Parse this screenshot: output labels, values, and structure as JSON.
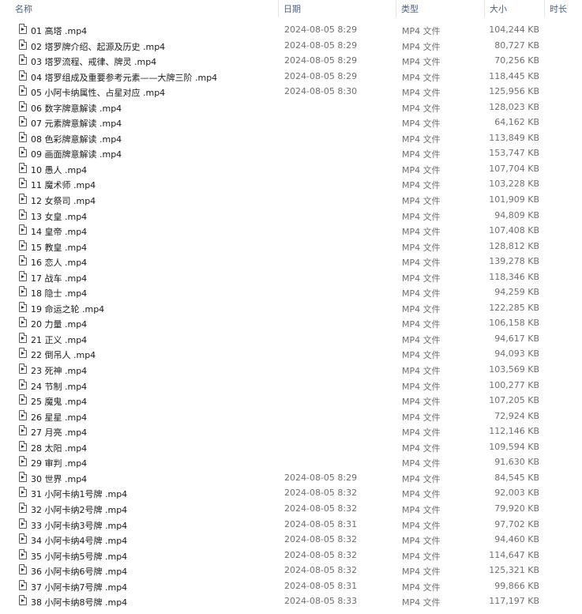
{
  "columns": {
    "name": "名称",
    "date": "日期",
    "type": "类型",
    "size": "大小",
    "duration": "时长"
  },
  "files": [
    {
      "name": "01 高塔 .mp4",
      "date": "2024-08-05 8:29",
      "type": "MP4 文件",
      "size": "104,244 KB"
    },
    {
      "name": "02 塔罗牌介绍、起源及历史 .mp4",
      "date": "2024-08-05 8:29",
      "type": "MP4 文件",
      "size": "80,727 KB"
    },
    {
      "name": "03 塔罗流程、戒律、牌灵 .mp4",
      "date": "2024-08-05 8:29",
      "type": "MP4 文件",
      "size": "70,256 KB"
    },
    {
      "name": "04 塔罗组成及重要参考元素——大牌三阶 .mp4",
      "date": "2024-08-05 8:29",
      "type": "MP4 文件",
      "size": "118,445 KB"
    },
    {
      "name": "05 小阿卡纳属性、占星对应 .mp4",
      "date": "2024-08-05 8:30",
      "type": "MP4 文件",
      "size": "125,956 KB"
    },
    {
      "name": "06 数字牌意解读 .mp4",
      "date": "",
      "type": "MP4 文件",
      "size": "128,023 KB"
    },
    {
      "name": "07 元素牌意解读 .mp4",
      "date": "",
      "type": "MP4 文件",
      "size": "64,162 KB"
    },
    {
      "name": "08 色彩牌意解读 .mp4",
      "date": "",
      "type": "MP4 文件",
      "size": "113,849 KB"
    },
    {
      "name": "09 画面牌意解读 .mp4",
      "date": "",
      "type": "MP4 文件",
      "size": "153,747 KB"
    },
    {
      "name": "10 愚人 .mp4",
      "date": "",
      "type": "MP4 文件",
      "size": "107,704 KB"
    },
    {
      "name": "11 魔术师 .mp4",
      "date": "",
      "type": "MP4 文件",
      "size": "103,228 KB"
    },
    {
      "name": "12 女祭司 .mp4",
      "date": "",
      "type": "MP4 文件",
      "size": "101,909 KB"
    },
    {
      "name": "13 女皇 .mp4",
      "date": "",
      "type": "MP4 文件",
      "size": "94,809 KB"
    },
    {
      "name": "14 皇帝 .mp4",
      "date": "",
      "type": "MP4 文件",
      "size": "107,408 KB"
    },
    {
      "name": "15 教皇 .mp4",
      "date": "",
      "type": "MP4 文件",
      "size": "128,812 KB"
    },
    {
      "name": "16 恋人 .mp4",
      "date": "",
      "type": "MP4 文件",
      "size": "139,278 KB"
    },
    {
      "name": "17 战车 .mp4",
      "date": "",
      "type": "MP4 文件",
      "size": "118,346 KB"
    },
    {
      "name": "18 隐士 .mp4",
      "date": "",
      "type": "MP4 文件",
      "size": "94,259 KB"
    },
    {
      "name": "19 命运之轮 .mp4",
      "date": "",
      "type": "MP4 文件",
      "size": "122,285 KB"
    },
    {
      "name": "20 力量 .mp4",
      "date": "",
      "type": "MP4 文件",
      "size": "106,158 KB"
    },
    {
      "name": "21 正义 .mp4",
      "date": "",
      "type": "MP4 文件",
      "size": "94,617 KB"
    },
    {
      "name": "22 倒吊人 .mp4",
      "date": "",
      "type": "MP4 文件",
      "size": "94,093 KB"
    },
    {
      "name": "23 死神 .mp4",
      "date": "",
      "type": "MP4 文件",
      "size": "103,569 KB"
    },
    {
      "name": "24 节制 .mp4",
      "date": "",
      "type": "MP4 文件",
      "size": "100,277 KB"
    },
    {
      "name": "25 魔鬼 .mp4",
      "date": "",
      "type": "MP4 文件",
      "size": "107,205 KB"
    },
    {
      "name": "26 星星 .mp4",
      "date": "",
      "type": "MP4 文件",
      "size": "72,924 KB"
    },
    {
      "name": "27 月亮 .mp4",
      "date": "",
      "type": "MP4 文件",
      "size": "112,146 KB"
    },
    {
      "name": "28 太阳 .mp4",
      "date": "",
      "type": "MP4 文件",
      "size": "109,594 KB"
    },
    {
      "name": "29 审判 .mp4",
      "date": "",
      "type": "MP4 文件",
      "size": "91,630 KB"
    },
    {
      "name": "30 世界 .mp4",
      "date": "2024-08-05 8:29",
      "type": "MP4 文件",
      "size": "84,545 KB"
    },
    {
      "name": "31 小阿卡纳1号牌 .mp4",
      "date": "2024-08-05 8:32",
      "type": "MP4 文件",
      "size": "92,003 KB"
    },
    {
      "name": "32 小阿卡纳2号牌 .mp4",
      "date": "2024-08-05 8:32",
      "type": "MP4 文件",
      "size": "79,920 KB"
    },
    {
      "name": "33 小阿卡纳3号牌 .mp4",
      "date": "2024-08-05 8:31",
      "type": "MP4 文件",
      "size": "97,702 KB"
    },
    {
      "name": "34 小阿卡纳4号牌 .mp4",
      "date": "2024-08-05 8:32",
      "type": "MP4 文件",
      "size": "94,460 KB"
    },
    {
      "name": "35 小阿卡纳5号牌 .mp4",
      "date": "2024-08-05 8:32",
      "type": "MP4 文件",
      "size": "114,647 KB"
    },
    {
      "name": "36 小阿卡纳6号牌 .mp4",
      "date": "2024-08-05 8:32",
      "type": "MP4 文件",
      "size": "125,321 KB"
    },
    {
      "name": "37 小阿卡纳7号牌 .mp4",
      "date": "2024-08-05 8:31",
      "type": "MP4 文件",
      "size": "99,866 KB"
    },
    {
      "name": "38 小阿卡纳8号牌 .mp4",
      "date": "2024-08-05 8:33",
      "type": "MP4 文件",
      "size": "117,197 KB"
    }
  ]
}
